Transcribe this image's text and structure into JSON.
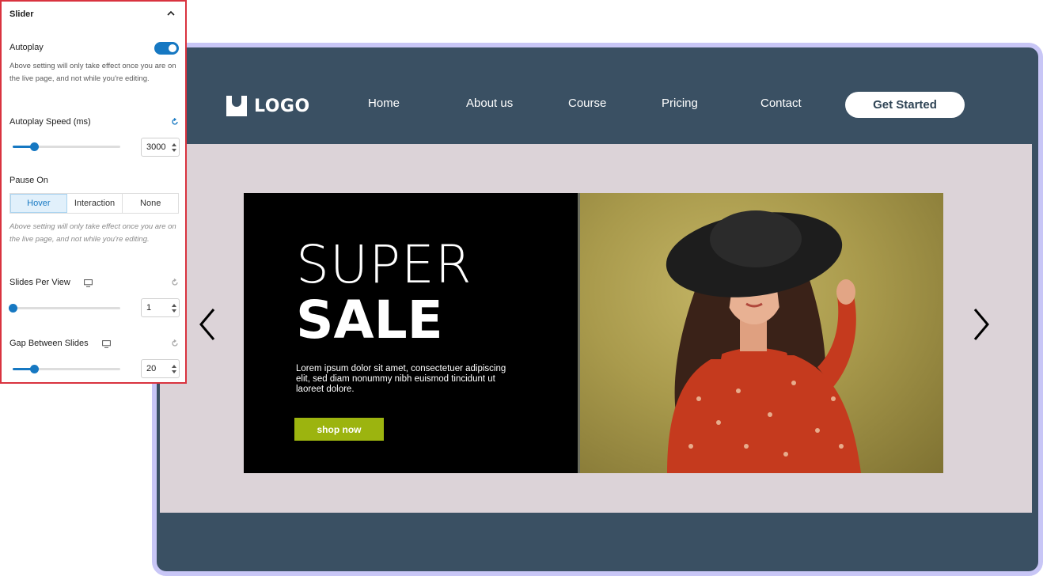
{
  "panel": {
    "title": "Slider",
    "autoplay": {
      "label": "Autoplay",
      "enabled": true,
      "help": "Above setting will only take effect once you are on the live page, and not while you're editing."
    },
    "autoplay_speed": {
      "label": "Autoplay Speed (ms)",
      "value": "3000",
      "slider_fraction": 0.2
    },
    "pause_on": {
      "label": "Pause On",
      "options": [
        "Hover",
        "Interaction",
        "None"
      ],
      "selected": "Hover",
      "help": "Above setting will only take effect once you are on the live page, and not while you're editing."
    },
    "slides_per_view": {
      "label": "Slides Per View",
      "value": "1",
      "slider_fraction": 0.0
    },
    "gap_between_slides": {
      "label": "Gap Between Slides",
      "value": "20",
      "slider_fraction": 0.2
    }
  },
  "site": {
    "logo_text": "LOGO",
    "nav": [
      "Home",
      "About us",
      "Course",
      "Pricing",
      "Contact"
    ],
    "cta": "Get Started",
    "slide": {
      "heading_light": "SUPER",
      "heading_bold": "SALE",
      "description": "Lorem ipsum dolor sit amet, consectetuer adipiscing elit, sed diam nonummy nibh euismod tincidunt ut laoreet dolore.",
      "button": "shop now"
    }
  },
  "colors": {
    "accent": "#1678c2",
    "site_bg": "#3a5063",
    "hero_bg": "#dcd3d8",
    "shop_button": "#9cb40f",
    "panel_border": "#d9333f",
    "frame_border": "#c8c6f6"
  },
  "icons": [
    "chevron-up-icon",
    "reset-icon",
    "desktop-icon",
    "chevron-left-icon",
    "chevron-right-icon",
    "spinner-arrows-icon"
  ]
}
